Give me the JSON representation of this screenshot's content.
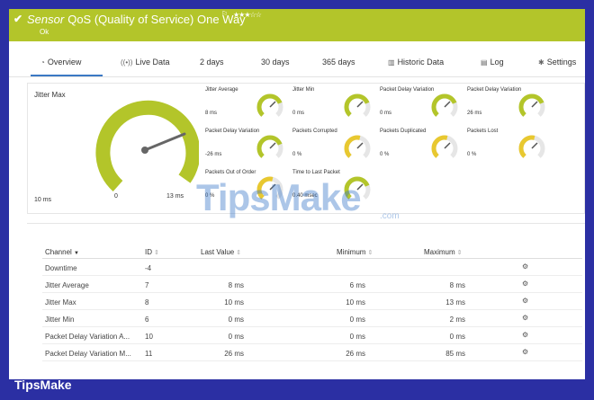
{
  "header": {
    "sensor_word": "Sensor",
    "title": "QoS (Quality of Service) One Way",
    "stars": "★★★☆☆",
    "status": "Ok",
    "accent_color": "#b3c52a"
  },
  "tabs": [
    {
      "label": "Overview",
      "icon": "overview-icon"
    },
    {
      "label": "Live Data",
      "icon": "live-data-icon"
    },
    {
      "label": "2  days"
    },
    {
      "label": "30 days"
    },
    {
      "label": "365 days"
    },
    {
      "label": "Historic Data",
      "icon": "historic-data-icon"
    },
    {
      "label": "Log",
      "icon": "log-icon"
    },
    {
      "label": "Settings",
      "icon": "settings-icon"
    }
  ],
  "main_gauge": {
    "title": "Jitter Max",
    "min_label": "10 ms",
    "zero_label": "0",
    "max_label": "13 ms"
  },
  "small_gauges": [
    {
      "label": "Jitter Average",
      "value": "8 ms",
      "fill": 0.75,
      "color": "#b3c52a"
    },
    {
      "label": "Jitter Min",
      "value": "0 ms",
      "fill": 0.75,
      "color": "#b3c52a"
    },
    {
      "label": "Packet Delay Variation",
      "value": "0 ms",
      "fill": 0.75,
      "color": "#b3c52a"
    },
    {
      "label": "Packet Delay Variation",
      "value": "26 ms",
      "fill": 0.75,
      "color": "#b3c52a"
    },
    {
      "label": "Packet Delay Variation",
      "value": "-26 ms",
      "fill": 0.75,
      "color": "#b3c52a"
    },
    {
      "label": "Packets Corrupted",
      "value": "0 %",
      "fill": 0.55,
      "color": "#e8c830"
    },
    {
      "label": "Packets Duplicated",
      "value": "0 %",
      "fill": 0.55,
      "color": "#e8c830"
    },
    {
      "label": "Packets Lost",
      "value": "0 %",
      "fill": 0.55,
      "color": "#e8c830"
    },
    {
      "label": "Packets Out of Order",
      "value": "0 %",
      "fill": 0.55,
      "color": "#e8c830"
    },
    {
      "label": "Time to Last Packet",
      "value": "0.40 msec",
      "fill": 0.75,
      "color": "#b3c52a"
    }
  ],
  "watermark": {
    "text": "TipsMake",
    "sub": ".com"
  },
  "table": {
    "headers": {
      "channel": "Channel",
      "id": "ID",
      "last_value": "Last Value",
      "minimum": "Minimum",
      "maximum": "Maximum"
    },
    "rows": [
      {
        "channel": "Downtime",
        "id": "-4",
        "last": "",
        "min": "",
        "max": ""
      },
      {
        "channel": "Jitter Average",
        "id": "7",
        "last": "8 ms",
        "min": "6 ms",
        "max": "8 ms"
      },
      {
        "channel": "Jitter Max",
        "id": "8",
        "last": "10 ms",
        "min": "10 ms",
        "max": "13 ms"
      },
      {
        "channel": "Jitter Min",
        "id": "6",
        "last": "0 ms",
        "min": "0 ms",
        "max": "2 ms"
      },
      {
        "channel": "Packet Delay Variation A...",
        "id": "10",
        "last": "0 ms",
        "min": "0 ms",
        "max": "0 ms"
      },
      {
        "channel": "Packet Delay Variation M...",
        "id": "11",
        "last": "26 ms",
        "min": "26 ms",
        "max": "85 ms"
      }
    ]
  },
  "footer": {
    "logo": "TipsMake"
  }
}
